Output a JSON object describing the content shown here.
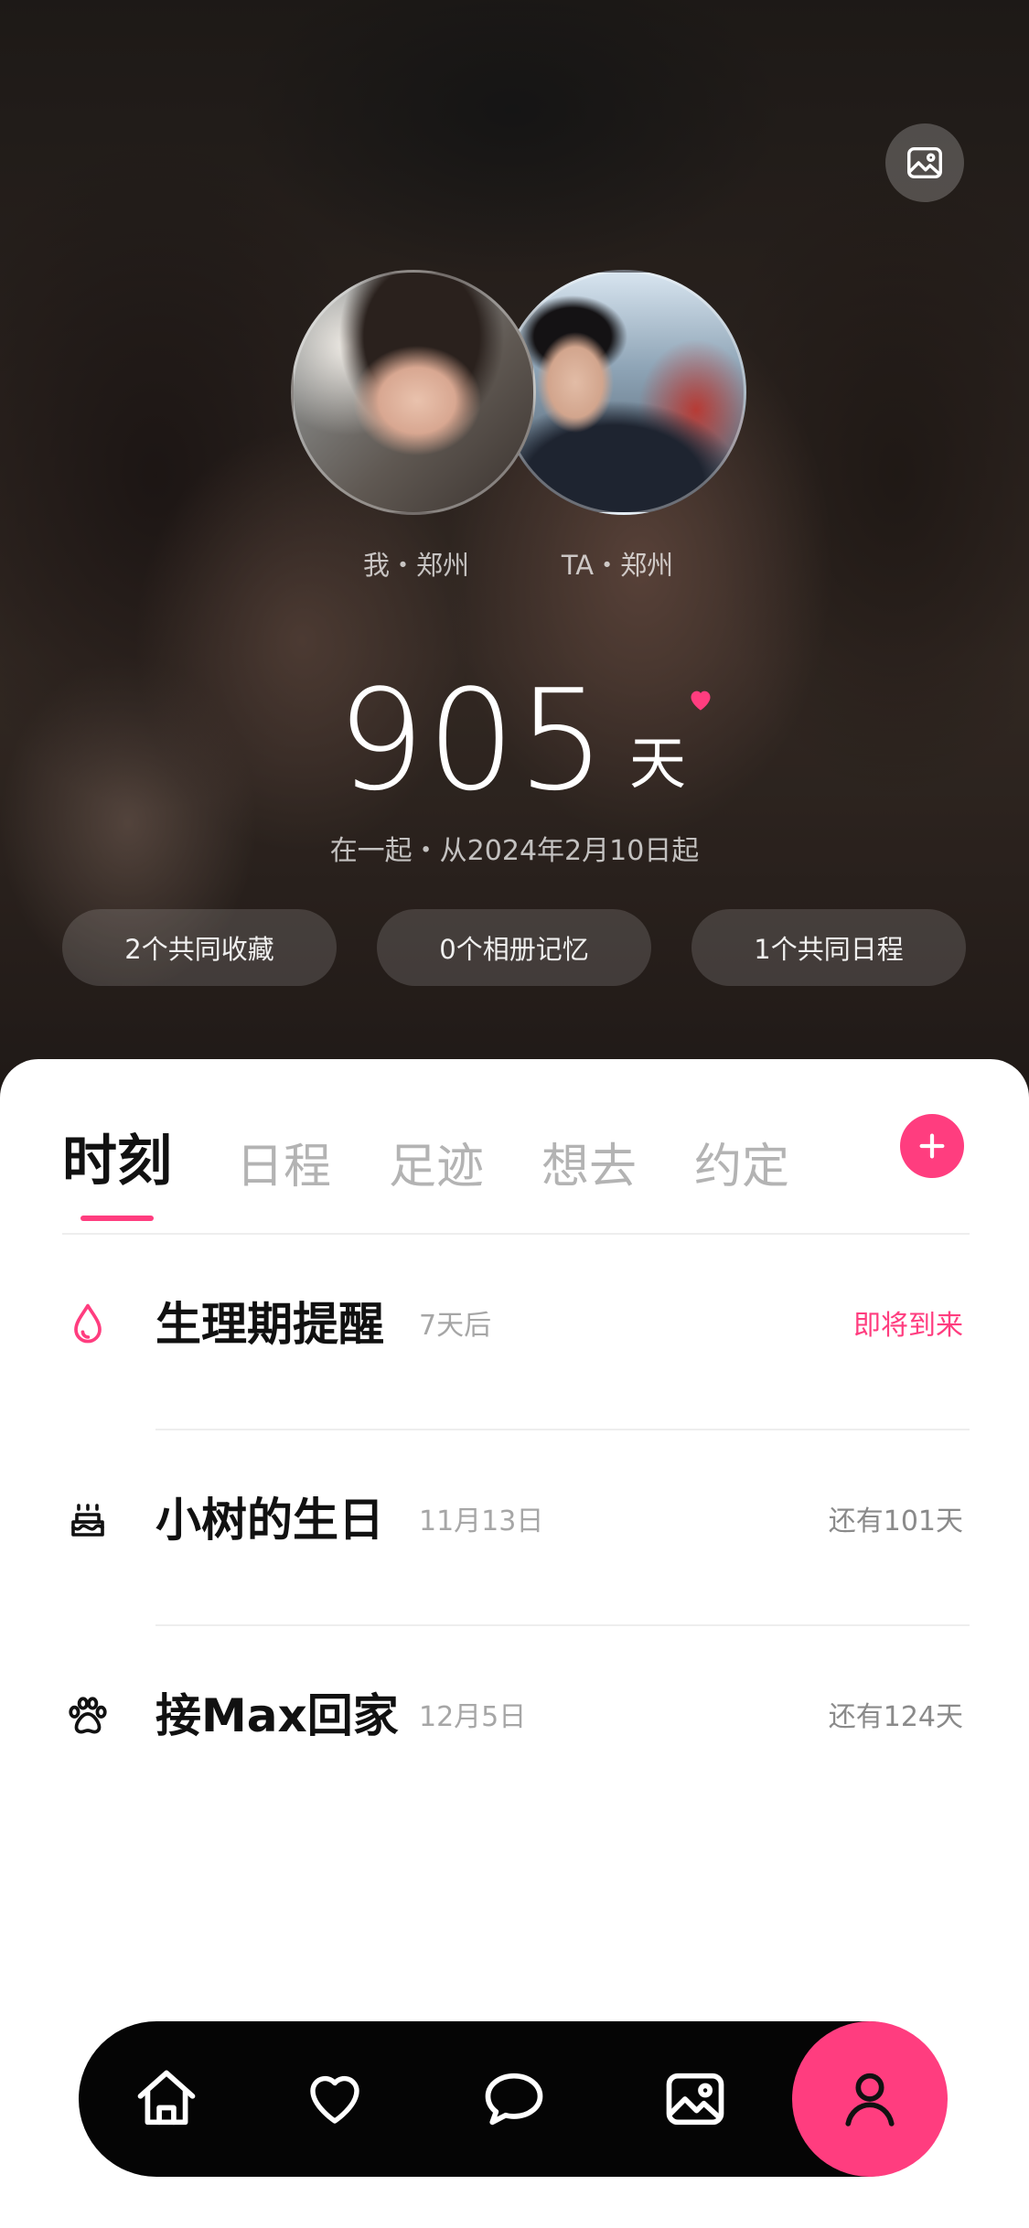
{
  "colors": {
    "accent": "#ff3d7f",
    "nav_background": "#050505",
    "text_primary": "#111111",
    "text_muted": "#a6a6a6",
    "tab_inactive": "#b3b3b3"
  },
  "hero": {
    "change_background_icon": "image-icon",
    "me": {
      "label": "我・郑州"
    },
    "ta": {
      "label": "TA・郑州"
    },
    "days": "905",
    "days_unit": "天",
    "heart_icon": "heart-icon",
    "since": "在一起・从2024年2月10日起",
    "chips": [
      "2个共同收藏",
      "0个相册记忆",
      "1个共同日程"
    ]
  },
  "tabs": {
    "items": [
      "时刻",
      "日程",
      "足迹",
      "想去",
      "约定"
    ],
    "active": "时刻",
    "add_icon": "plus-icon"
  },
  "moments": [
    {
      "icon": "drop-icon",
      "title": "生理期提醒",
      "date": "7天后",
      "status": "即将到来",
      "status_accent": true
    },
    {
      "icon": "cake-icon",
      "title": "小树的生日",
      "date": "11月13日",
      "status": "还有101天",
      "status_accent": false
    },
    {
      "icon": "paw-icon",
      "title": "接Max回家",
      "date": "12月5日",
      "status": "还有124天",
      "status_accent": false
    }
  ],
  "nav": {
    "items": [
      "home-icon",
      "heart-icon",
      "chat-icon",
      "photo-icon",
      "user-icon"
    ],
    "active": "user-icon"
  }
}
